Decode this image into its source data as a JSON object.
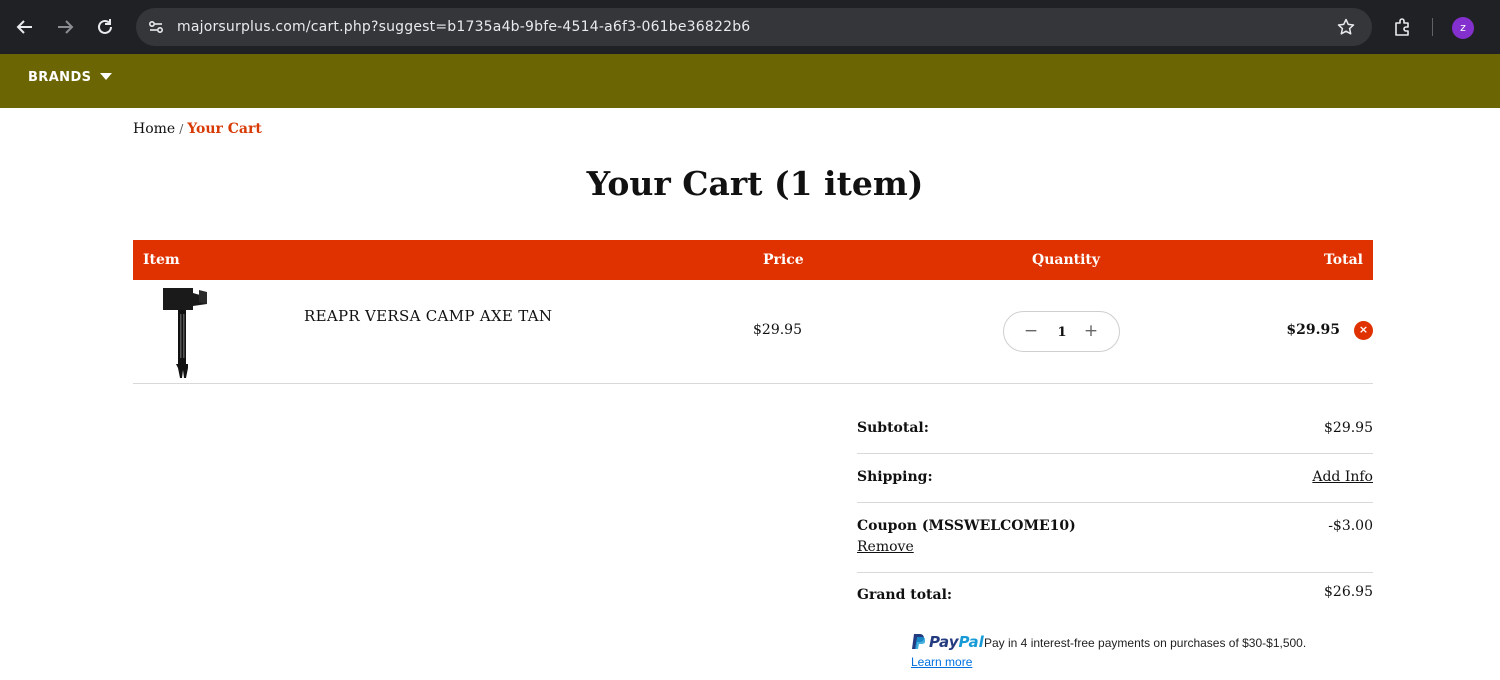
{
  "browser": {
    "url": "majorsurplus.com/cart.php?suggest=b1735a4b-9bfe-4514-a6f3-061be36822b6",
    "profile_initial": "z",
    "icons": [
      "back-icon",
      "forward-icon",
      "reload-icon",
      "site-info-icon",
      "star-icon",
      "extensions-icon"
    ]
  },
  "site_nav": {
    "brands_label": "BRANDS"
  },
  "breadcrumb": {
    "home": "Home",
    "separator": "/",
    "current": "Your Cart"
  },
  "page": {
    "title": "Your Cart (1 item)"
  },
  "cart": {
    "columns": {
      "item": "Item",
      "price": "Price",
      "quantity": "Quantity",
      "total": "Total"
    },
    "items": [
      {
        "name": "REAPR VERSA CAMP AXE TAN",
        "price": "$29.95",
        "quantity": "1",
        "total": "$29.95",
        "qty_minus": "−",
        "qty_plus": "+",
        "remove_symbol": "×"
      }
    ]
  },
  "totals": {
    "subtotal_label": "Subtotal:",
    "subtotal_value": "$29.95",
    "shipping_label": "Shipping:",
    "shipping_link": "Add Info",
    "coupon_label": "Coupon (MSSWELCOME10)",
    "coupon_remove": "Remove",
    "coupon_value": "-$3.00",
    "grand_total_label": "Grand total:",
    "grand_total_value": "$26.95"
  },
  "paypal": {
    "logo_pay": "Pay",
    "logo_pal": "Pal",
    "message": "Pay in 4 interest-free payments on purchases of $30-$1,500.",
    "learn_more": "Learn more"
  },
  "colors": {
    "site_bar": "#6b6603",
    "accent": "#e03200",
    "breadcrumb_current": "#d83a05",
    "paypal_blue": "#253b80",
    "paypal_light": "#179bd7"
  }
}
